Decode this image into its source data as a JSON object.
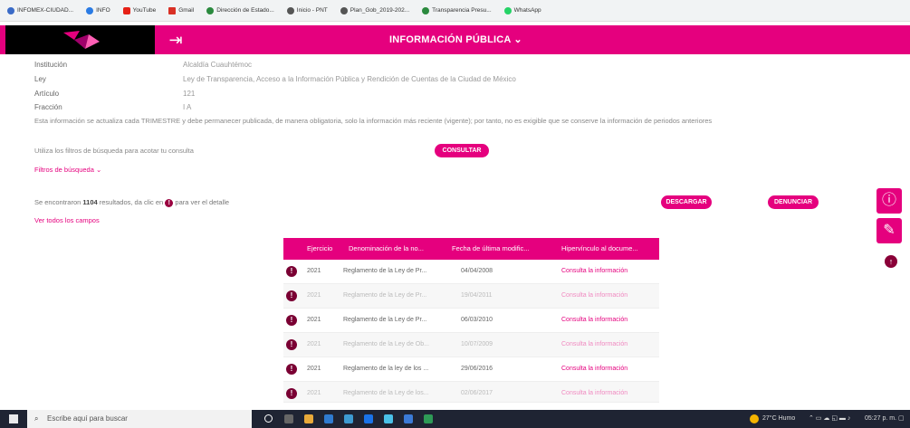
{
  "bookmarks": [
    {
      "label": "INFOMEX-CIUDAD...",
      "color": "#3a6bc7"
    },
    {
      "label": "INFO",
      "color": "#2a7be4"
    },
    {
      "label": "YouTube",
      "color": "#e62117"
    },
    {
      "label": "Gmail",
      "color": "#d93025"
    },
    {
      "label": "Dirección de Estado...",
      "color": "#2b8a3e"
    },
    {
      "label": "Inicio - PNT",
      "color": "#555555"
    },
    {
      "label": "Plan_Gob_2019-202...",
      "color": "#555555"
    },
    {
      "label": "Transparencia Presu...",
      "color": "#2b8a3e"
    },
    {
      "label": "WhatsApp",
      "color": "#25d366"
    }
  ],
  "header": {
    "title": "INFORMACIÓN PÚBLICA ⌄",
    "exit_glyph": "⇥"
  },
  "meta": [
    {
      "label": "Institución",
      "value": "Alcaldía Cuauhtémoc"
    },
    {
      "label": "Ley",
      "value": "Ley de Transparencia, Acceso a la Información Pública y Rendición de Cuentas de la Ciudad de México"
    },
    {
      "label": "Artículo",
      "value": "121"
    },
    {
      "label": "Fracción",
      "value": "I A"
    }
  ],
  "note": "Esta información se actualiza cada TRIMESTRE y debe permanecer publicada, de manera obligatoria, solo la información más reciente (vigente); por tanto, no es exigible que se conserve la información de periodos anteriores",
  "filter_hint": "Utiliza los filtros de búsqueda para acotar tu consulta",
  "consult_label": "CONSULTAR",
  "filter_toggle": "Filtros de búsqueda ⌄",
  "results": {
    "prefix": "Se encontraron",
    "count": "1104",
    "mid": "resultados, da clic en",
    "suffix": "para ver el detalle"
  },
  "download_label": "DESCARGAR",
  "report_label": "DENUNCIAR",
  "all_fields": "Ver todos los campos",
  "table": {
    "headers": [
      "Ejercicio",
      "Denominación de la no...",
      "Fecha de última modific...",
      "Hipervínculo al docume..."
    ],
    "rows": [
      {
        "year": "2021",
        "name": "Reglamento de la Ley de Pr...",
        "date": "04/04/2008",
        "link": "Consulta la información"
      },
      {
        "year": "2021",
        "name": "Reglamento de la Ley de Pr...",
        "date": "19/04/2011",
        "link": "Consulta la información"
      },
      {
        "year": "2021",
        "name": "Reglamento de la Ley de Pr...",
        "date": "06/03/2010",
        "link": "Consulta la información"
      },
      {
        "year": "2021",
        "name": "Reglamento de la Ley de Ob...",
        "date": "10/07/2009",
        "link": "Consulta la información"
      },
      {
        "year": "2021",
        "name": "Reglamento de la ley de los ...",
        "date": "29/06/2016",
        "link": "Consulta la información"
      },
      {
        "year": "2021",
        "name": "Reglamento de la Ley de los...",
        "date": "02/06/2017",
        "link": "Consulta la información"
      }
    ]
  },
  "taskbar": {
    "search_placeholder": "Escribe aquí para buscar",
    "weather": "27°C Humo",
    "time": "05:27 p. m."
  }
}
